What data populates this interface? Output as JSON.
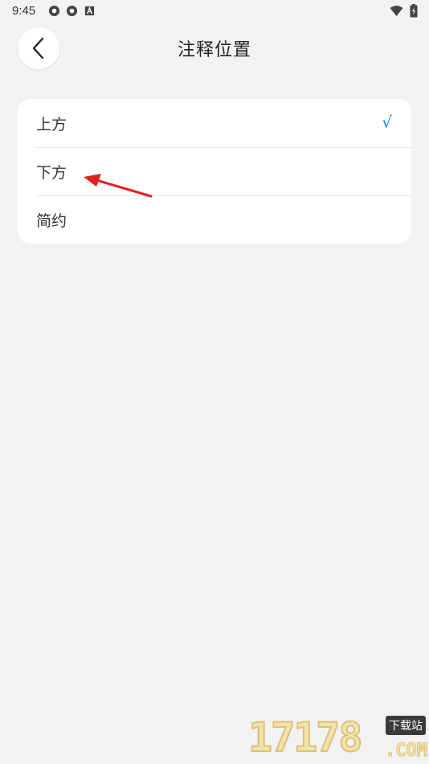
{
  "status_bar": {
    "time": "9:45"
  },
  "header": {
    "title": "注释位置"
  },
  "options": [
    {
      "label": "上方",
      "selected": true
    },
    {
      "label": "下方",
      "selected": false
    },
    {
      "label": "简约",
      "selected": false
    }
  ],
  "check_mark": "√",
  "colors": {
    "accent": "#1e88e5",
    "annotation_arrow": "#e02020",
    "background": "#f2f2f2"
  },
  "watermark": {
    "number": "17178",
    "badge": "下载站",
    "suffix": ".COM"
  }
}
